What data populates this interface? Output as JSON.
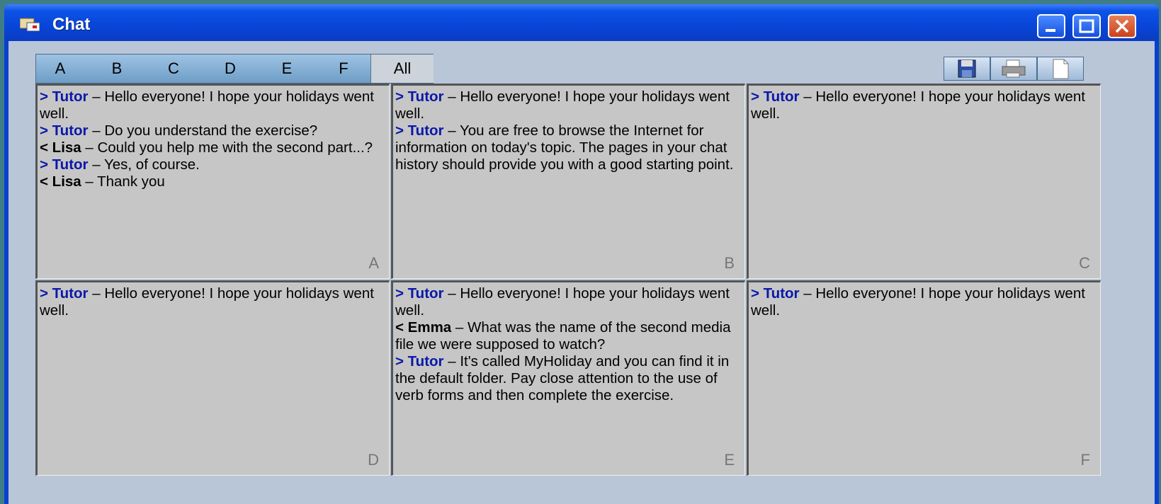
{
  "window": {
    "title": "Chat"
  },
  "tabs": [
    "A",
    "B",
    "C",
    "D",
    "E",
    "F",
    "All"
  ],
  "toolbar": [
    "save-icon",
    "print-icon",
    "new-document-icon"
  ],
  "panels": [
    {
      "letter": "A",
      "messages": [
        {
          "prefix": "> Tutor",
          "text": " – Hello everyone! I hope your holidays went well."
        },
        {
          "prefix": "> Tutor",
          "text": " – Do you understand the exercise?"
        },
        {
          "prefix": "< Lisa",
          "text": " – Could you help me with the second part...?"
        },
        {
          "prefix": "> Tutor",
          "text": " – Yes, of course."
        },
        {
          "prefix": "< Lisa",
          "text": " – Thank you"
        }
      ]
    },
    {
      "letter": "B",
      "messages": [
        {
          "prefix": "> Tutor",
          "text": " – Hello everyone! I hope your holidays went well."
        },
        {
          "prefix": "> Tutor",
          "text": " – You are free to browse the Internet for information on today's topic. The pages in your chat history should provide you with a good starting point."
        }
      ]
    },
    {
      "letter": "C",
      "messages": [
        {
          "prefix": "> Tutor",
          "text": " – Hello everyone! I hope your holidays went well."
        }
      ]
    },
    {
      "letter": "D",
      "messages": [
        {
          "prefix": "> Tutor",
          "text": " – Hello everyone! I hope your holidays went well."
        }
      ]
    },
    {
      "letter": "E",
      "messages": [
        {
          "prefix": "> Tutor",
          "text": " – Hello everyone! I hope your holidays went well."
        },
        {
          "prefix": "< Emma",
          "text": " – What was the name of the second media file we were supposed to watch?"
        },
        {
          "prefix": "> Tutor",
          "text": " – It's called MyHoliday and you can find it in the default folder. Pay close attention to the use of verb forms and then complete the exercise."
        }
      ]
    },
    {
      "letter": "F",
      "messages": [
        {
          "prefix": "> Tutor",
          "text": " – Hello everyone! I hope your holidays went well."
        }
      ]
    }
  ]
}
